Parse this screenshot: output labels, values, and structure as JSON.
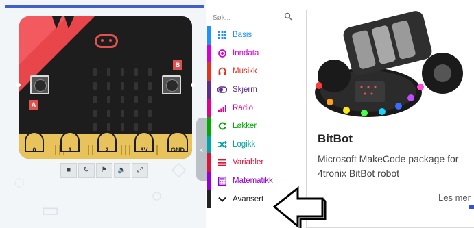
{
  "simulator": {
    "pins": [
      "0",
      "1",
      "2",
      "3V",
      "GND"
    ],
    "button_a": "A",
    "button_b": "B",
    "tools": [
      {
        "name": "stop-icon",
        "glyph": "■"
      },
      {
        "name": "restart-icon",
        "glyph": "↻"
      },
      {
        "name": "debug-icon",
        "glyph": "⚑"
      },
      {
        "name": "mute-icon",
        "glyph": "🔈"
      },
      {
        "name": "fullscreen-icon",
        "glyph": "⤢"
      }
    ],
    "collapse_glyph": "‹"
  },
  "toolbox": {
    "search_placeholder": "Søk...",
    "categories": [
      {
        "label": "Basis",
        "color": "#1e90ff",
        "icon": "grid-icon"
      },
      {
        "label": "Inndata",
        "color": "#d400d4",
        "icon": "target-icon"
      },
      {
        "label": "Musikk",
        "color": "#e63022",
        "icon": "headphones-icon"
      },
      {
        "label": "Skjerm",
        "color": "#5c2d91",
        "icon": "toggle-icon"
      },
      {
        "label": "Radio",
        "color": "#e3008c",
        "icon": "signal-icon"
      },
      {
        "label": "Løkker",
        "color": "#00aa00",
        "icon": "refresh-icon"
      },
      {
        "label": "Logikk",
        "color": "#00a4a6",
        "icon": "shuffle-icon"
      },
      {
        "label": "Variabler",
        "color": "#dc143c",
        "icon": "list-icon"
      },
      {
        "label": "Matematikk",
        "color": "#9400d3",
        "icon": "calculator-icon"
      },
      {
        "label": "Avansert",
        "color": "#222222",
        "icon": "chevron-down-icon"
      }
    ]
  },
  "extension": {
    "title": "BitBot",
    "description": "Microsoft MakeCode package for 4tronix BitBot robot",
    "link": "Les mer"
  }
}
